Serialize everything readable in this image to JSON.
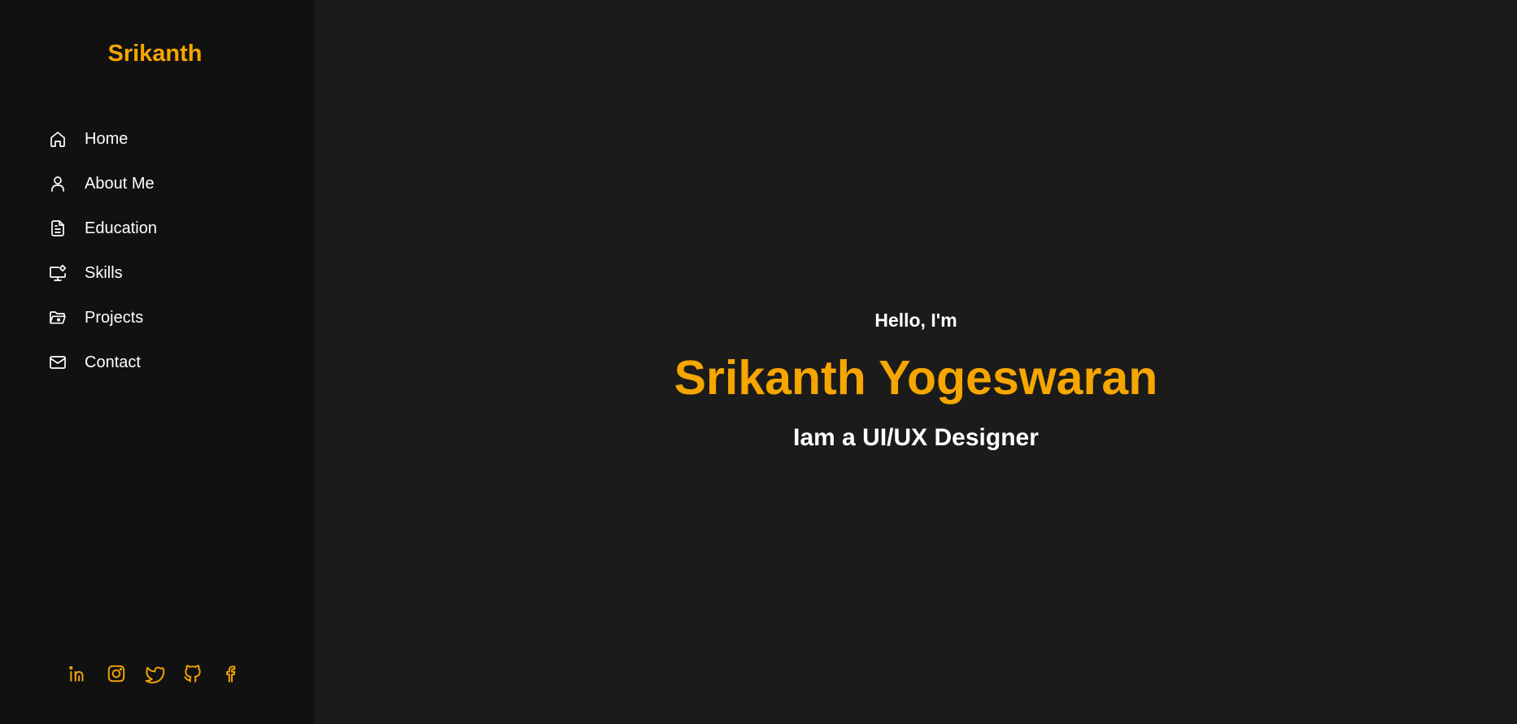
{
  "sidebar": {
    "brand": "Srikanth",
    "nav": [
      {
        "label": "Home",
        "icon": "home-icon"
      },
      {
        "label": "About Me",
        "icon": "user-icon"
      },
      {
        "label": "Education",
        "icon": "document-icon"
      },
      {
        "label": "Skills",
        "icon": "monitor-gear-icon"
      },
      {
        "label": "Projects",
        "icon": "folder-open-icon"
      },
      {
        "label": "Contact",
        "icon": "mail-icon"
      }
    ],
    "social": [
      {
        "icon": "linkedin-icon"
      },
      {
        "icon": "instagram-icon"
      },
      {
        "icon": "twitter-icon"
      },
      {
        "icon": "github-icon"
      },
      {
        "icon": "facebook-icon"
      }
    ]
  },
  "hero": {
    "greeting": "Hello, I'm",
    "name": "Srikanth Yogeswaran",
    "role": "Iam a UI/UX Designer"
  },
  "colors": {
    "accent": "#f5a600",
    "sidebar_bg": "#111111",
    "main_bg": "#1b1b1b",
    "text": "#ffffff"
  }
}
